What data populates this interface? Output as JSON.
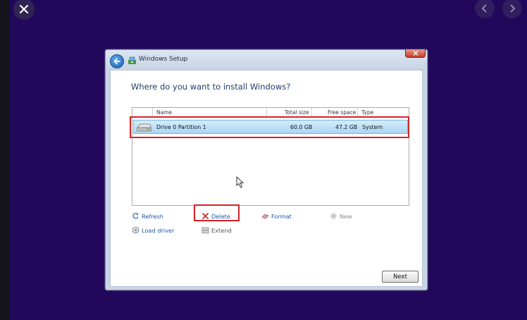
{
  "window": {
    "title": "Windows Setup"
  },
  "question": "Where do you want to install Windows?",
  "table": {
    "columns": [
      "Name",
      "Total size",
      "Free space",
      "Type"
    ],
    "rows": [
      {
        "name": "Drive 0 Partition 1",
        "total": "60.0 GB",
        "free": "47.2 GB",
        "type": "System"
      }
    ]
  },
  "actions": {
    "refresh": "Refresh",
    "delete": "Delete",
    "format": "Format",
    "new": "New",
    "load_driver": "Load driver",
    "extend": "Extend"
  },
  "next_label": "Next",
  "colors": {
    "background": "#22085a",
    "highlight": "#d2232a",
    "selection": "#a9d6f5",
    "link": "#1f56a8"
  },
  "icons": {
    "viewer_close": "close-icon",
    "viewer_prev": "chevron-left-icon",
    "viewer_next": "chevron-right-icon",
    "back": "back-arrow-icon",
    "drive": "hard-drive-icon"
  }
}
